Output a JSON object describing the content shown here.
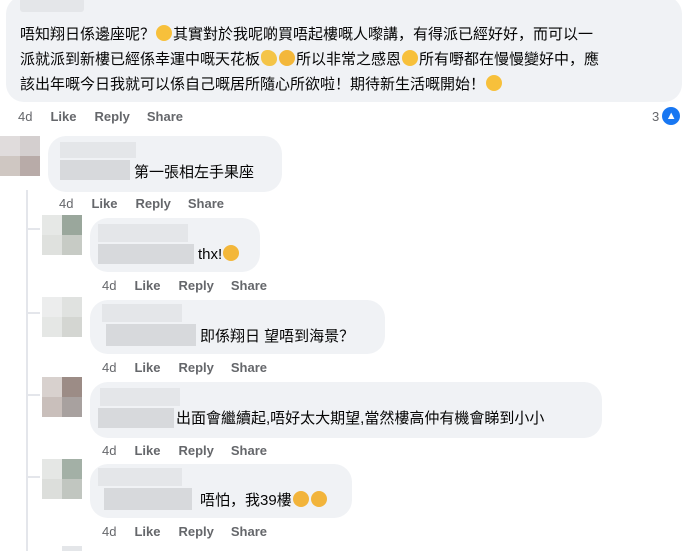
{
  "main_comment": {
    "lines": [
      "唔知翔日係邊座呢？",
      "其實對於我呢啲買唔起樓嘅人嚟講，有得派已經好好，而可以一",
      "派就派到新樓已經係幸運中嘅天花板",
      "所以非常之感恩",
      "所有嘢都在慢慢變好中，應",
      "該出年嘅今日我就可以係自己嘅居所隨心所欲啦！期待新生活嘅開始！"
    ],
    "time": "4d",
    "like": "Like",
    "reply": "Reply",
    "share": "Share",
    "reaction_count": "3"
  },
  "replies": [
    {
      "text": "第一張相左手果座",
      "time": "4d",
      "like": "Like",
      "reply": "Reply",
      "share": "Share"
    },
    {
      "text": "thx!",
      "time": "4d",
      "like": "Like",
      "reply": "Reply",
      "share": "Share"
    },
    {
      "text": "即係翔日 望唔到海景？",
      "time": "4d",
      "like": "Like",
      "reply": "Reply",
      "share": "Share"
    },
    {
      "text": "出面會繼續起,唔好太大期望,當然樓高仲有機會睇到小小",
      "time": "4d",
      "like": "Like",
      "reply": "Reply",
      "share": "Share"
    },
    {
      "text": "唔怕，我39樓",
      "time": "4d",
      "like": "Like",
      "reply": "Reply",
      "share": "Share"
    }
  ],
  "icons": {
    "smile": "smiling-face-icon",
    "clap": "clapping-hands-icon",
    "relieved": "relieved-face-icon",
    "scream": "screaming-face-icon",
    "like": "thumbs-up-icon"
  },
  "colors": {
    "bubble": "#f0f2f5",
    "action": "#65676b",
    "like_blue": "#1877f2"
  }
}
